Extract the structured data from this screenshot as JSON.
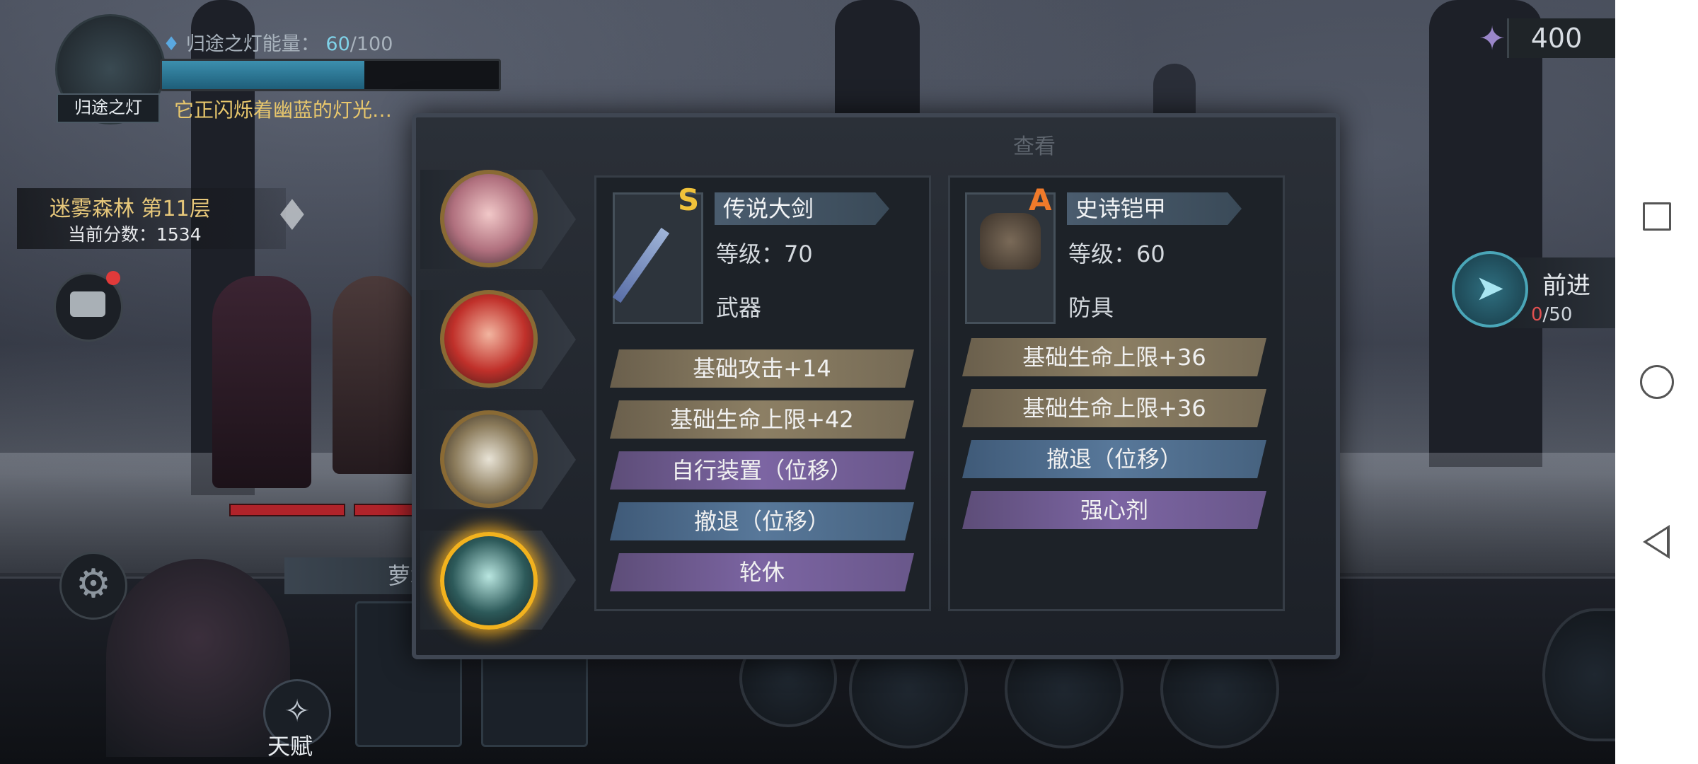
{
  "hud": {
    "lamp_label": "归途之灯",
    "energy_label": "归途之灯能量：",
    "energy_current": "60",
    "energy_max": "/100",
    "energy_fraction": 0.6,
    "lamp_desc": "它正闪烁着幽蓝的灯光…",
    "stage_name": "迷雾森林  第11层",
    "score": "当前分数：1534",
    "currency": "400",
    "forward_label": "前进",
    "forward_count_zero": "0",
    "forward_count_max": "/50",
    "character_name": "萝塔",
    "talent_label": "天赋"
  },
  "modal": {
    "title": "查看",
    "characters": [
      {
        "name": "pink-hair-hero",
        "selected": false
      },
      {
        "name": "red-hair-hero",
        "selected": false
      },
      {
        "name": "witch-hat-hero",
        "selected": false
      },
      {
        "name": "lota-hero",
        "selected": true
      }
    ],
    "weapon": {
      "grade": "S",
      "name": "传说大剑",
      "level": "等级：70",
      "type": "武器",
      "stats": [
        {
          "label": "基础攻击+14",
          "style": "tan"
        },
        {
          "label": "基础生命上限+42",
          "style": "tan"
        },
        {
          "label": "自行装置（位移）",
          "style": "purple"
        },
        {
          "label": "撤退（位移）",
          "style": "blue"
        },
        {
          "label": "轮休",
          "style": "purple"
        }
      ]
    },
    "armor": {
      "grade": "A",
      "name": "史诗铠甲",
      "level": "等级：60",
      "type": "防具",
      "stats": [
        {
          "label": "基础生命上限+36",
          "style": "tan"
        },
        {
          "label": "基础生命上限+36",
          "style": "tan"
        },
        {
          "label": "撤退（位移）",
          "style": "blue"
        },
        {
          "label": "强心剂",
          "style": "purple"
        }
      ]
    }
  },
  "colors": {
    "grade_s": "#f0c23a",
    "grade_a": "#f07a2a",
    "selected_glow": "#f2b21e"
  }
}
